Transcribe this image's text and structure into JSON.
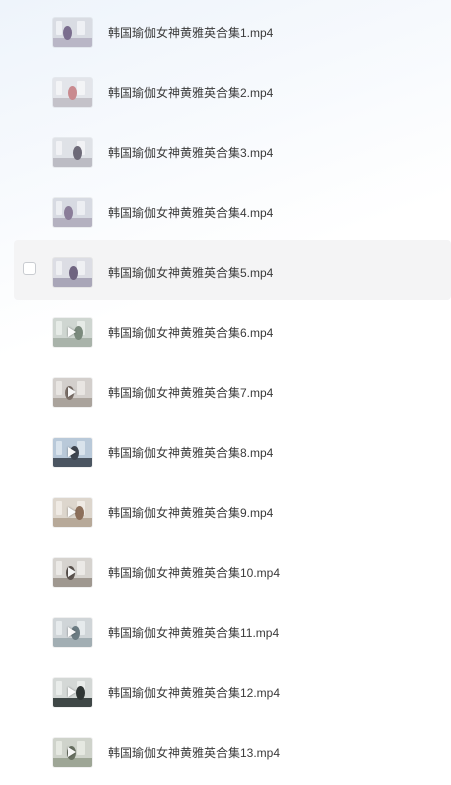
{
  "files": [
    {
      "name": "韩国瑜伽女神黄雅英合集1.mp4",
      "thumb_icon": "video-thumbnail-icon",
      "thumb": {
        "bg": "#d9dce3",
        "floor": "#b9b6c6",
        "stripe": "#eef0f4",
        "figure": "#7a6d8e"
      }
    },
    {
      "name": "韩国瑜伽女神黄雅英合集2.mp4",
      "thumb_icon": "video-thumbnail-icon",
      "thumb": {
        "bg": "#e3e5ea",
        "floor": "#c4c2c9",
        "stripe": "#f3f4f6",
        "figure": "#c98a8f"
      }
    },
    {
      "name": "韩国瑜伽女神黄雅英合集3.mp4",
      "thumb_icon": "video-thumbnail-icon",
      "thumb": {
        "bg": "#dfe2e7",
        "floor": "#bcbcc4",
        "stripe": "#f1f2f5",
        "figure": "#6d6a78"
      }
    },
    {
      "name": "韩国瑜伽女神黄雅英合集4.mp4",
      "thumb_icon": "video-thumbnail-icon",
      "thumb": {
        "bg": "#d7dae2",
        "floor": "#b4b1c0",
        "stripe": "#eceef2",
        "figure": "#8a7d99"
      }
    },
    {
      "name": "韩国瑜伽女神黄雅英合集5.mp4",
      "thumb_icon": "video-thumbnail-icon",
      "thumb": {
        "bg": "#dcdde4",
        "floor": "#a9a6b8",
        "stripe": "#eff0f3",
        "figure": "#6f6480"
      }
    },
    {
      "name": "韩国瑜伽女神黄雅英合集6.mp4",
      "thumb_icon": "video-thumbnail-icon",
      "thumb": {
        "bg": "#cfd6d1",
        "floor": "#a9b3aa",
        "stripe": "#e6ebe7",
        "figure": "#7b8a7d"
      }
    },
    {
      "name": "韩国瑜伽女神黄雅英合集7.mp4",
      "thumb_icon": "video-thumbnail-icon",
      "thumb": {
        "bg": "#d3cfcc",
        "floor": "#aaa39c",
        "stripe": "#e8e5e2",
        "figure": "#7d716a"
      }
    },
    {
      "name": "韩国瑜伽女神黄雅英合集8.mp4",
      "thumb_icon": "video-thumbnail-icon",
      "thumb": {
        "bg": "#b9c9d9",
        "floor": "#4b5561",
        "stripe": "#d9e3ec",
        "figure": "#3e454f"
      }
    },
    {
      "name": "韩国瑜伽女神黄雅英合集9.mp4",
      "thumb_icon": "video-thumbnail-icon",
      "thumb": {
        "bg": "#ddd6cd",
        "floor": "#b7a999",
        "stripe": "#efeae4",
        "figure": "#8c6f5a"
      }
    },
    {
      "name": "韩国瑜伽女神黄雅英合集10.mp4",
      "thumb_icon": "video-thumbnail-icon",
      "thumb": {
        "bg": "#d6d3cf",
        "floor": "#9f9890",
        "stripe": "#ebe9e6",
        "figure": "#5e5651"
      }
    },
    {
      "name": "韩国瑜伽女神黄雅英合集11.mp4",
      "thumb_icon": "video-thumbnail-icon",
      "thumb": {
        "bg": "#d0d5d8",
        "floor": "#a2aeb3",
        "stripe": "#e6eaec",
        "figure": "#6c7c83"
      }
    },
    {
      "name": "韩国瑜伽女神黄雅英合集12.mp4",
      "thumb_icon": "video-thumbnail-icon",
      "thumb": {
        "bg": "#d4d8d6",
        "floor": "#3f4746",
        "stripe": "#e9ecea",
        "figure": "#2f3534"
      }
    },
    {
      "name": "韩国瑜伽女神黄雅英合集13.mp4",
      "thumb_icon": "video-thumbnail-icon",
      "thumb": {
        "bg": "#cfd3cb",
        "floor": "#9ea696",
        "stripe": "#e5e8e1",
        "figure": "#6a7263"
      }
    }
  ],
  "hovered_index": 4,
  "play_icon_rows": [
    5,
    6,
    7,
    8,
    9,
    10,
    11,
    12
  ]
}
